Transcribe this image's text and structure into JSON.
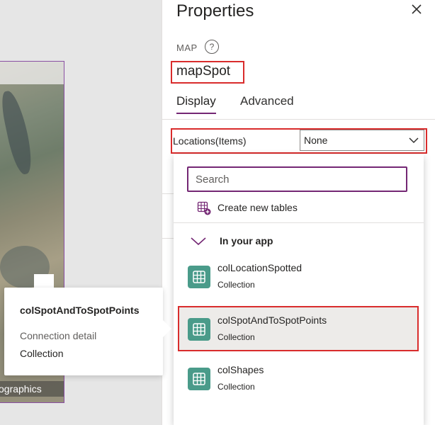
{
  "canvas": {
    "map_label": "ographics"
  },
  "tooltip": {
    "title": "colSpotAndToSpotPoints",
    "detail_label": "Connection detail",
    "detail_value": "Collection"
  },
  "panel": {
    "title": "Properties",
    "control_type": "MAP",
    "control_name": "mapSpot",
    "tabs": [
      {
        "label": "Display",
        "active": true
      },
      {
        "label": "Advanced",
        "active": false
      }
    ],
    "locations": {
      "label": "Locations(Items)",
      "value": "None"
    }
  },
  "flyout": {
    "search_placeholder": "Search",
    "create_label": "Create new tables",
    "group_label": "In your app",
    "items": [
      {
        "title": "colLocationSpotted",
        "subtitle": "Collection",
        "selected": false
      },
      {
        "title": "colSpotAndToSpotPoints",
        "subtitle": "Collection",
        "selected": true
      },
      {
        "title": "colShapes",
        "subtitle": "Collection",
        "selected": false
      }
    ]
  },
  "colors": {
    "accent": "#742774",
    "highlight_border": "#d92c2c",
    "table_icon": "#4a9b8a",
    "selected_bg": "#edebe9"
  }
}
